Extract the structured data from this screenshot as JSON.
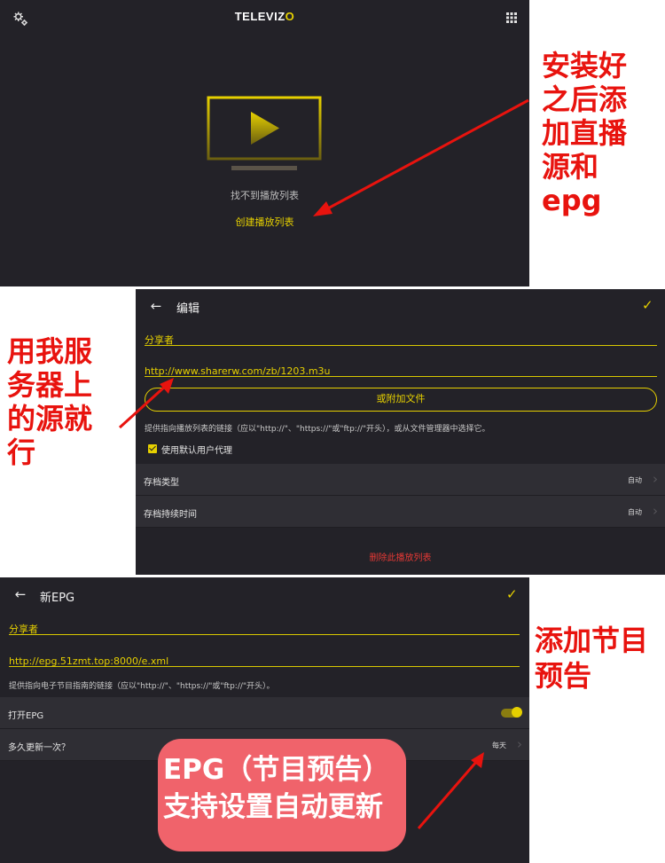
{
  "panel1": {
    "brand": "TELEVIZ",
    "brand_suffix": "O",
    "empty_text": "找不到播放列表",
    "create_link": "创建播放列表"
  },
  "panel2": {
    "title": "编辑",
    "name_label": "分享者",
    "url_value": "http://www.sharerw.com/zb/1203.m3u",
    "attach_button": "或附加文件",
    "hint": "提供指向播放列表的链接（应以\"http://\"、\"https://\"或\"ftp://\"开头），或从文件管理器中选择它。",
    "checkbox_label": "使用默认用户代理",
    "checkbox_checked": true,
    "rows": [
      {
        "label": "存档类型",
        "value": "自动"
      },
      {
        "label": "存档持续时间",
        "value": "自动"
      }
    ],
    "delete_link": "删除此播放列表"
  },
  "panel3": {
    "title": "新EPG",
    "name_label": "分享者",
    "url_value": "http://epg.51zmt.top:8000/e.xml",
    "hint": "提供指向电子节目指南的链接（应以\"http://\"、\"https://\"或\"ftp://\"开头）。",
    "rows": [
      {
        "label": "打开EPG",
        "toggle_on": true
      },
      {
        "label": "多久更新一次？",
        "value": "每天"
      }
    ]
  },
  "annotations": {
    "top_right": [
      "安装好",
      "之后添",
      "加直播",
      "源和",
      "epg"
    ],
    "middle_left": [
      "用我服",
      "务器上",
      "的源就",
      "行"
    ],
    "bottom_right": [
      "添加节目",
      "预告"
    ],
    "callout": [
      "EPG（节目预告）",
      "支持设置自动更新"
    ]
  },
  "colors": {
    "accent": "#e6d000",
    "background": "#232228",
    "row_background": "#2f2e34",
    "annotation_red": "#e8130e",
    "callout_background": "#f0636b",
    "delete_red": "#e53935"
  },
  "icons": {
    "settings": "gears-icon",
    "apps": "grid-icon",
    "empty_state": "tv-play-icon",
    "back": "back-arrow-icon",
    "confirm": "check-icon",
    "chevron": "chevron-right-icon"
  }
}
